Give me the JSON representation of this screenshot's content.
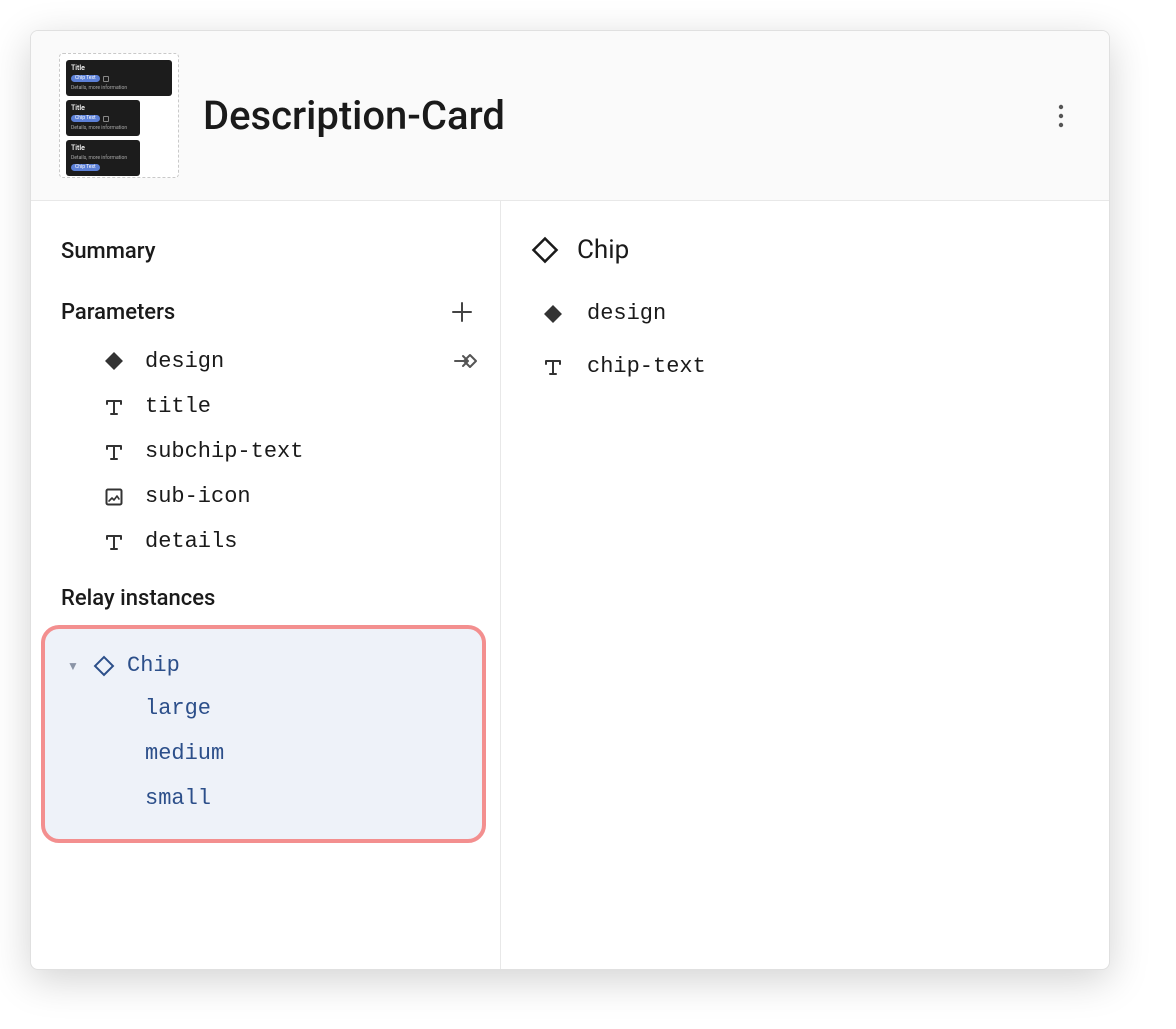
{
  "header": {
    "title": "Description-Card"
  },
  "left": {
    "summary_label": "Summary",
    "parameters_label": "Parameters",
    "parameters": [
      {
        "icon": "instance",
        "label": "design"
      },
      {
        "icon": "text",
        "label": "title"
      },
      {
        "icon": "text",
        "label": "subchip-text"
      },
      {
        "icon": "image",
        "label": "sub-icon"
      },
      {
        "icon": "text",
        "label": "details"
      }
    ],
    "relay_label": "Relay instances",
    "relay": {
      "name": "Chip",
      "variants": [
        "large",
        "medium",
        "small"
      ]
    }
  },
  "right": {
    "component_name": "Chip",
    "properties": [
      {
        "icon": "instance",
        "label": "design"
      },
      {
        "icon": "text",
        "label": "chip-text"
      }
    ]
  },
  "thumbnail": {
    "row1": {
      "title": "Title",
      "chip": "Chip Text",
      "details": "Details, more information"
    },
    "row2": {
      "title": "Title",
      "chip": "Chip Text",
      "details": "Details, more information"
    },
    "row3": {
      "title": "Title",
      "chip": "Chip Text",
      "details": "Details, more information"
    }
  }
}
